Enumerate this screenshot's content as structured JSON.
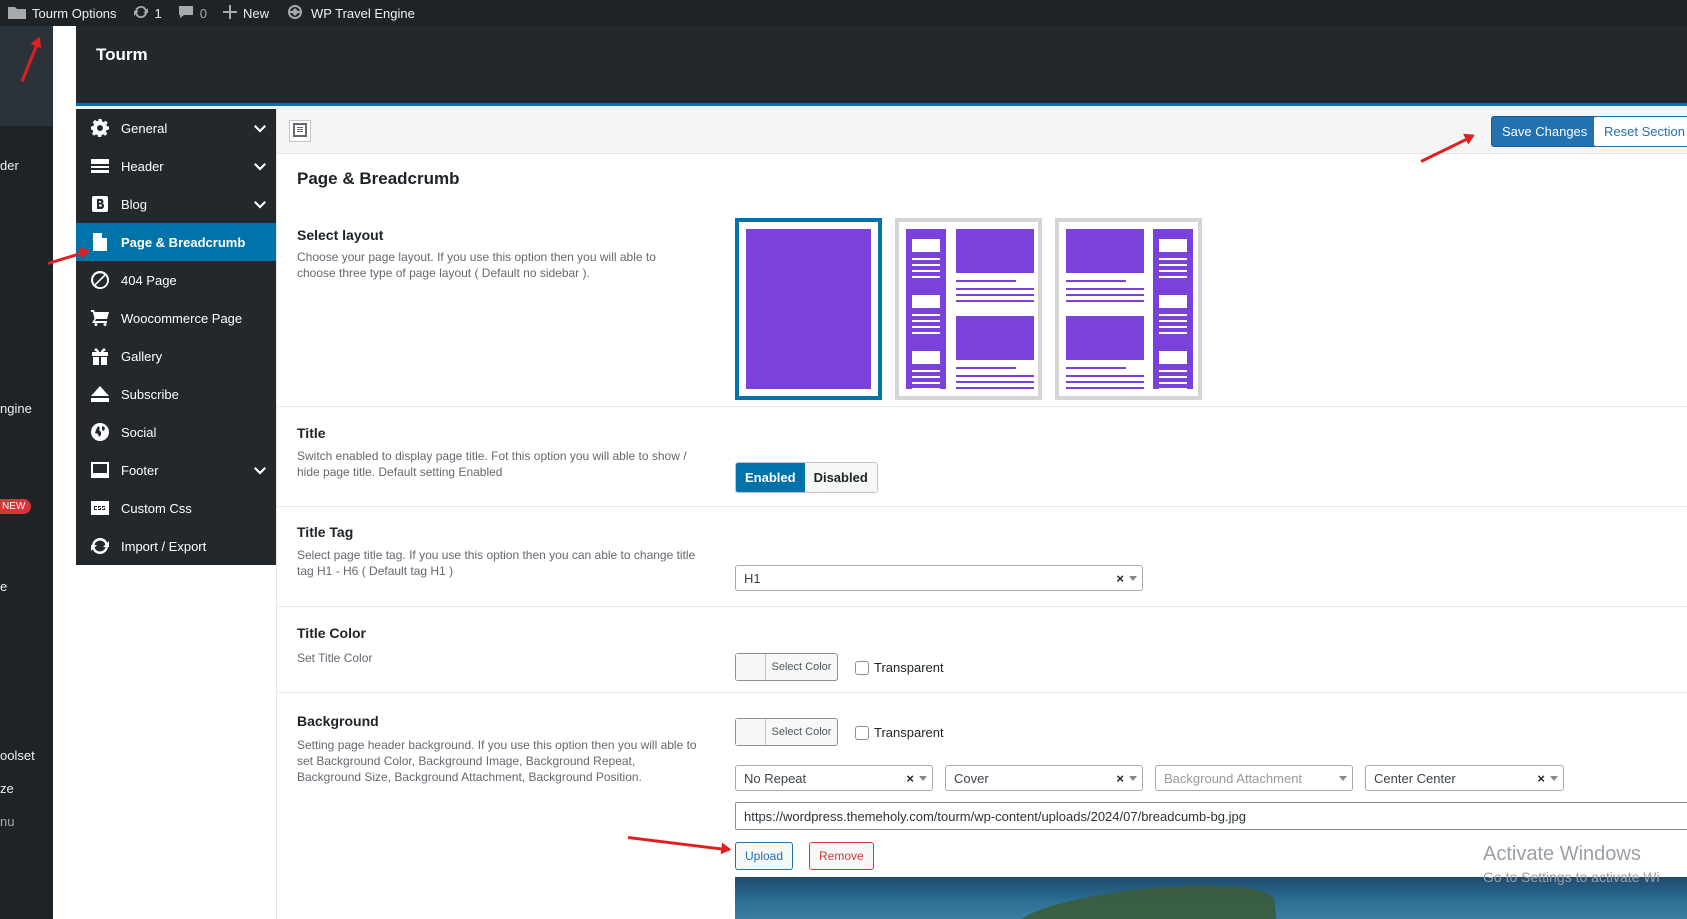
{
  "adminbar": {
    "site_title": "Tourm Options",
    "updates_count": "1",
    "comments_count": "0",
    "new_label": "New",
    "plugin_label": "WP Travel Engine"
  },
  "wp_menu_fragments": [
    "der",
    "ngine",
    "NEW",
    "e",
    "oolset",
    "ze",
    "nu"
  ],
  "panel": {
    "title": "Tourm"
  },
  "toolbar": {
    "save_label": "Save Changes",
    "reset_label": "Reset Section"
  },
  "sidebar": {
    "items": [
      {
        "label": "General",
        "icon": "gear-icon",
        "has_children": true,
        "active": false
      },
      {
        "label": "Header",
        "icon": "header-icon",
        "has_children": true,
        "active": false
      },
      {
        "label": "Blog",
        "icon": "blog-icon",
        "has_children": true,
        "active": false
      },
      {
        "label": "Page & Breadcrumb",
        "icon": "page-icon",
        "has_children": false,
        "active": true
      },
      {
        "label": "404 Page",
        "icon": "ban-icon",
        "has_children": false,
        "active": false
      },
      {
        "label": "Woocommerce Page",
        "icon": "cart-icon",
        "has_children": false,
        "active": false
      },
      {
        "label": "Gallery",
        "icon": "gift-icon",
        "has_children": false,
        "active": false
      },
      {
        "label": "Subscribe",
        "icon": "eject-icon",
        "has_children": false,
        "active": false
      },
      {
        "label": "Social",
        "icon": "globe-icon",
        "has_children": false,
        "active": false
      },
      {
        "label": "Footer",
        "icon": "footer-icon",
        "has_children": true,
        "active": false
      },
      {
        "label": "Custom Css",
        "icon": "css-icon",
        "has_children": false,
        "active": false
      },
      {
        "label": "Import / Export",
        "icon": "refresh-icon",
        "has_children": false,
        "active": false
      }
    ]
  },
  "section": {
    "title": "Page & Breadcrumb",
    "layout": {
      "label": "Select layout",
      "desc": "Choose your page layout. If you use this option then you will able to choose three type of page layout ( Default no sidebar ).",
      "selected": "no-sidebar"
    },
    "title_toggle": {
      "label": "Title",
      "desc": "Switch enabled to display page title. Fot this option you will able to show / hide page title. Default setting Enabled",
      "on_label": "Enabled",
      "off_label": "Disabled"
    },
    "title_tag": {
      "label": "Title Tag",
      "desc": "Select page title tag. If you use this option then you can able to change title tag H1 - H6 ( Default tag H1 )",
      "value": "H1"
    },
    "title_color": {
      "label": "Title Color",
      "desc": "Set Title Color",
      "button_label": "Select Color",
      "transparent_label": "Transparent"
    },
    "background": {
      "label": "Background",
      "desc": "Setting page header background. If you use this option then you will able to set Background Color, Background Image, Background Repeat, Background Size, Background Attachment, Background Position.",
      "button_label": "Select Color",
      "transparent_label": "Transparent",
      "repeat": "No Repeat",
      "size": "Cover",
      "attachment_placeholder": "Background Attachment",
      "position": "Center Center",
      "url": "https://wordpress.themeholy.com/tourm/wp-content/uploads/2024/07/breadcumb-bg.jpg",
      "upload_label": "Upload",
      "remove_label": "Remove"
    }
  },
  "watermark": {
    "line1": "Activate Windows",
    "line2": "Go to Settings to activate Wi"
  },
  "colors": {
    "accent": "#0073aa",
    "admin_bg": "#1d2327",
    "layout_purple": "#7b42db",
    "arrow": "#e02020"
  }
}
